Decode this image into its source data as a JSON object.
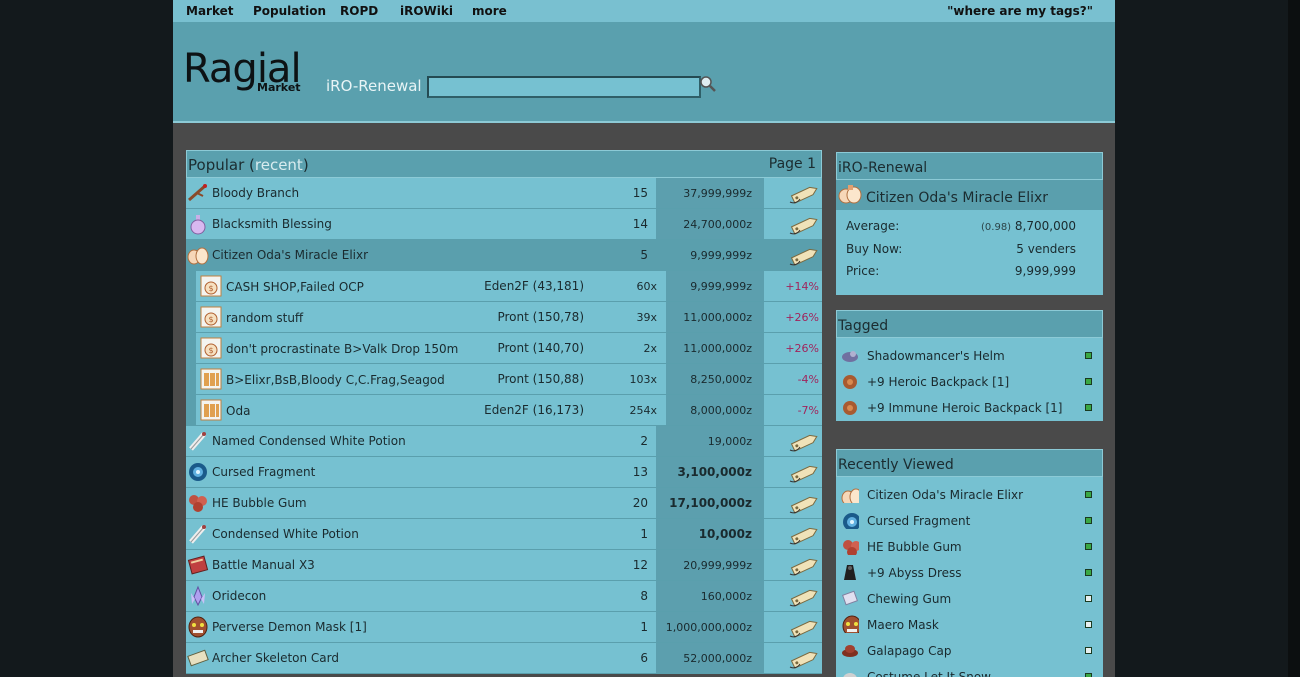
{
  "nav": {
    "items": [
      "Market",
      "Population",
      "ROPD",
      "iROWiki",
      "more"
    ],
    "right": "\"where are my tags?\""
  },
  "header": {
    "logo": "Ragial",
    "logo_sub": "Market",
    "server": "iRO-Renewal",
    "search_placeholder": ""
  },
  "popular": {
    "title": "Popular",
    "recent_link": "recent",
    "page": "Page 1",
    "rows": [
      {
        "name": "Bloody Branch",
        "qty": "15",
        "price": "37,999,999z",
        "bold": false,
        "icon": "branch-icon"
      },
      {
        "name": "Blacksmith Blessing",
        "qty": "14",
        "price": "24,700,000z",
        "bold": false,
        "icon": "potion-icon"
      },
      {
        "name": "Citizen Oda's Miracle Elixr",
        "qty": "5",
        "price": "9,999,999z",
        "bold": false,
        "icon": "elixir-icon",
        "selected": true,
        "vendors": [
          {
            "name": "CASH SHOP,Failed OCP",
            "loc": "Eden2F (43,181)",
            "qty": "60x",
            "price": "9,999,999z",
            "pct": "+14%",
            "icon": "money-bag-icon"
          },
          {
            "name": "random stuff",
            "loc": "Pront (150,78)",
            "qty": "39x",
            "price": "11,000,000z",
            "pct": "+26%",
            "icon": "money-bag-icon"
          },
          {
            "name": "don't procrastinate B>Valk Drop 150m",
            "loc": "Pront (140,70)",
            "qty": "2x",
            "price": "11,000,000z",
            "pct": "+26%",
            "icon": "money-bag-icon"
          },
          {
            "name": "B>Elixr,BsB,Bloody C,C.Frag,Seagod",
            "loc": "Pront (150,88)",
            "qty": "103x",
            "price": "8,250,000z",
            "pct": "-4%",
            "icon": "shop-stall-icon"
          },
          {
            "name": "Oda",
            "loc": "Eden2F (16,173)",
            "qty": "254x",
            "price": "8,000,000z",
            "pct": "-7%",
            "icon": "shop-stall-icon"
          }
        ]
      },
      {
        "name": "Named Condensed White Potion",
        "qty": "2",
        "price": "19,000z",
        "bold": false,
        "icon": "vial-icon"
      },
      {
        "name": "Cursed Fragment",
        "qty": "13",
        "price": "3,100,000z",
        "bold": true,
        "icon": "orb-icon"
      },
      {
        "name": "HE Bubble Gum",
        "qty": "20",
        "price": "17,100,000z",
        "bold": true,
        "icon": "gum-icon"
      },
      {
        "name": "Condensed White Potion",
        "qty": "1",
        "price": "10,000z",
        "bold": true,
        "icon": "vial-icon"
      },
      {
        "name": "Battle Manual X3",
        "qty": "12",
        "price": "20,999,999z",
        "bold": false,
        "icon": "book-icon"
      },
      {
        "name": "Oridecon",
        "qty": "8",
        "price": "160,000z",
        "bold": false,
        "icon": "crystal-icon"
      },
      {
        "name": "Perverse Demon Mask [1]",
        "qty": "1",
        "price": "1,000,000,000z",
        "bold": false,
        "icon": "mask-icon"
      },
      {
        "name": "Archer Skeleton Card",
        "qty": "6",
        "price": "52,000,000z",
        "bold": false,
        "icon": "card-icon"
      }
    ]
  },
  "summary": {
    "server": "iRO-Renewal",
    "item": "Citizen Oda's Miracle Elixr",
    "average_label": "Average:",
    "average_ratio": "(0.98)",
    "average_value": "8,700,000",
    "buynow_label": "Buy Now:",
    "buynow_value": "5 venders",
    "price_label": "Price:",
    "price_value": "9,999,999"
  },
  "tagged": {
    "title": "Tagged",
    "items": [
      {
        "name": "Shadowmancer's Helm",
        "status": "green",
        "icon": "helm-icon"
      },
      {
        "name": "+9 Heroic Backpack [1]",
        "status": "green",
        "icon": "backpack-icon"
      },
      {
        "name": "+9 Immune Heroic Backpack [1]",
        "status": "green",
        "icon": "backpack-icon"
      }
    ]
  },
  "recent": {
    "title": "Recently Viewed",
    "items": [
      {
        "name": "Citizen Oda's Miracle Elixr",
        "status": "green",
        "icon": "elixir-icon"
      },
      {
        "name": "Cursed Fragment",
        "status": "green",
        "icon": "orb-icon"
      },
      {
        "name": "HE Bubble Gum",
        "status": "green",
        "icon": "gum-icon"
      },
      {
        "name": "+9 Abyss Dress",
        "status": "green",
        "icon": "dress-icon"
      },
      {
        "name": "Chewing Gum",
        "status": "empty",
        "icon": "gum-pack-icon"
      },
      {
        "name": "Maero Mask",
        "status": "empty",
        "icon": "mask-icon"
      },
      {
        "name": "Galapago Cap",
        "status": "empty",
        "icon": "cap-icon"
      },
      {
        "name": "Costume Let It Snow",
        "status": "green",
        "icon": "snow-icon"
      }
    ]
  },
  "colors": {
    "accent": "#76c1d1",
    "header": "#5aa0ae",
    "status_green": "#3aa843",
    "negative_pct": "#a0245c"
  }
}
